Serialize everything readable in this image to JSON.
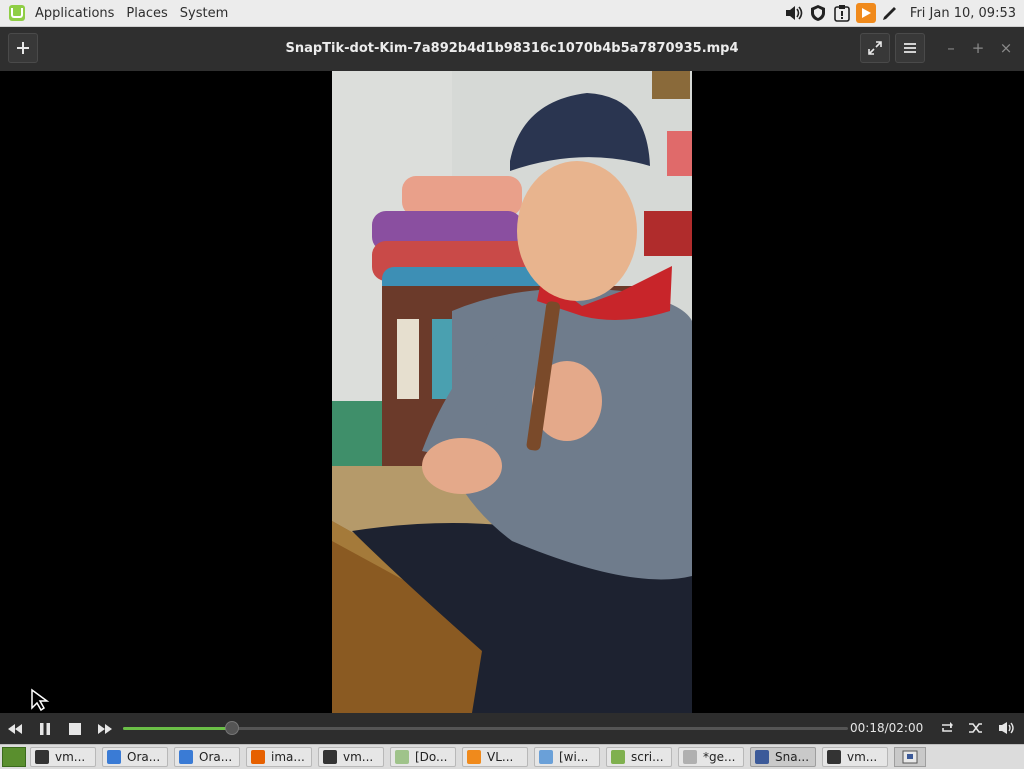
{
  "top_panel": {
    "menus": [
      "Applications",
      "Places",
      "System"
    ],
    "clock": "Fri Jan 10, 09:53",
    "tray_icons": [
      "volume-icon",
      "shield-icon",
      "clipboard-alert-icon",
      "vlc-icon",
      "pen-icon"
    ]
  },
  "player": {
    "title": "SnapTik-dot-Kim-7a892b4d1b98316c1070b4b5a7870935.mp4",
    "elapsed_total": "00:18/02:00",
    "progress": 0.15
  },
  "taskbar": {
    "tasks": [
      {
        "label": "vm...",
        "icon": "terminal-icon",
        "color": "#333333"
      },
      {
        "label": "Ora...",
        "icon": "virtualbox-icon",
        "color": "#3a7bd5"
      },
      {
        "label": "Ora...",
        "icon": "virtualbox-icon",
        "color": "#3a7bd5"
      },
      {
        "label": "ima...",
        "icon": "firefox-icon",
        "color": "#e66000"
      },
      {
        "label": "vm...",
        "icon": "terminal-icon",
        "color": "#333333"
      },
      {
        "label": "[Do...",
        "icon": "folder-icon",
        "color": "#9fc38a"
      },
      {
        "label": "VL...",
        "icon": "vlc-icon",
        "color": "#f08a1c"
      },
      {
        "label": "[wi...",
        "icon": "network-icon",
        "color": "#6aa0d8"
      },
      {
        "label": "scri...",
        "icon": "folder-icon",
        "color": "#7fb04f"
      },
      {
        "label": "*ge...",
        "icon": "text-editor-icon",
        "color": "#b0b0b0"
      },
      {
        "label": "Sna...",
        "icon": "video-player-icon",
        "color": "#3c5a99",
        "active": true
      },
      {
        "label": "vm...",
        "icon": "terminal-icon",
        "color": "#333333"
      }
    ]
  },
  "colors": {
    "accent": "#6bbf47",
    "header_bg": "#2f2f2f",
    "panel_bg": "#ececec"
  }
}
